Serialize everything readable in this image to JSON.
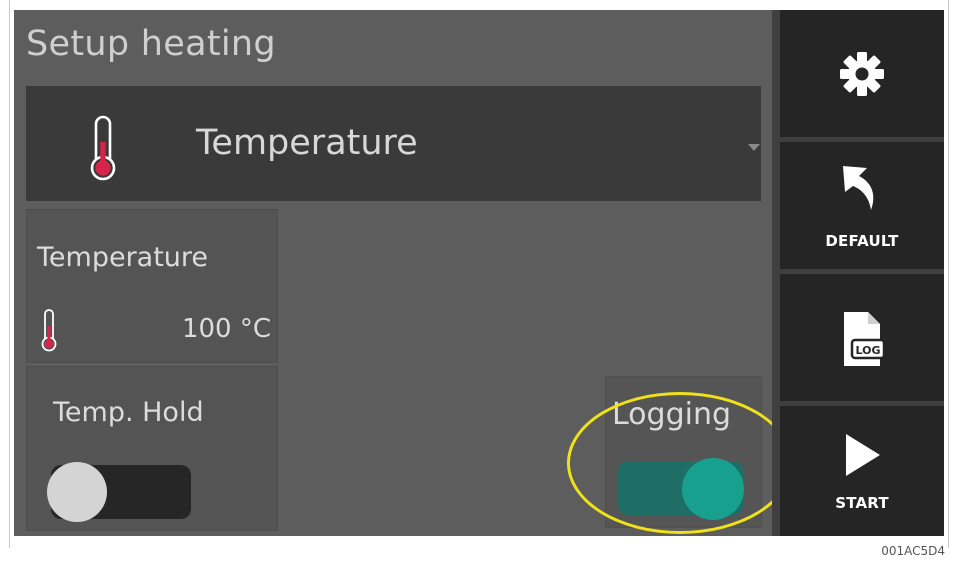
{
  "header": {
    "title": "Setup heating"
  },
  "mode_select": {
    "selected": "Temperature",
    "icon": "thermometer-icon"
  },
  "temperature_tile": {
    "label": "Temperature",
    "value": "100 °C",
    "icon": "thermometer-icon"
  },
  "temp_hold": {
    "label": "Temp. Hold",
    "state": "off"
  },
  "logging": {
    "label": "Logging",
    "state": "on"
  },
  "sidebar": {
    "settings": {
      "icon": "gear-icon"
    },
    "default": {
      "label": "DEFAULT",
      "icon": "undo-arrow-icon"
    },
    "log": {
      "icon": "log-file-icon",
      "icon_text": "LOG"
    },
    "start": {
      "label": "START",
      "icon": "play-icon"
    }
  },
  "figure_code": "001AC5D4",
  "colors": {
    "screen_bg": "#5d5d5d",
    "panel_dark": "#3a3a3a",
    "sidebar_button": "#252525",
    "toggle_on_track": "#1f6e66",
    "toggle_on_knob": "#18a08f",
    "toggle_off_knob": "#d4d4d4",
    "highlight": "#efe21a",
    "thermo_red": "#d6244a"
  }
}
